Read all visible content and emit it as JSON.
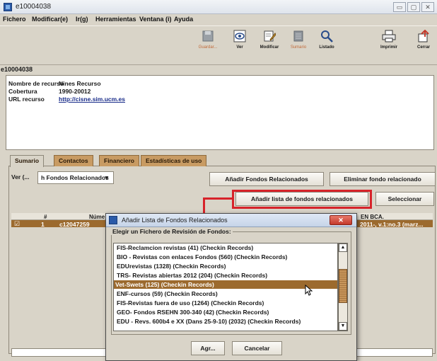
{
  "window": {
    "title": "e10004038",
    "min_glyph": "▭",
    "max_glyph": "▢",
    "close_glyph": "✕"
  },
  "menu": [
    {
      "label": "Fichero"
    },
    {
      "label": "Modificar(e)"
    },
    {
      "label": "Ir(g)"
    },
    {
      "label": "Herramientas"
    },
    {
      "label": "Ventana (i)"
    },
    {
      "label": "Ayuda"
    }
  ],
  "toolbar": {
    "guardar": "Guardar...",
    "ver": "Ver",
    "modificar": "Modificar",
    "sumario": "Sumario",
    "listado": "Listado",
    "imprimir": "Imprimir",
    "cerrar": "Cerrar"
  },
  "record": {
    "id": "e10004038",
    "fields": [
      {
        "label": "Nombre de recurso",
        "value": "Nines Recurso"
      },
      {
        "label": "Cobertura",
        "value": "1990-20012"
      },
      {
        "label": "URL recurso",
        "value": "http://cisne.sim.ucm.es"
      }
    ]
  },
  "tabs": [
    {
      "label": "Sumario"
    },
    {
      "label": "Contactos"
    },
    {
      "label": "Financiero"
    },
    {
      "label": "Estadísticas de uso"
    }
  ],
  "view": {
    "label": "Ver (...",
    "selected": "h Fondos Relacionados",
    "chevron": "▼"
  },
  "actions": {
    "add_related": "Añadir Fondos Relacionados",
    "remove_related": "Eliminar fondo relacionado",
    "add_list": "Añadir lista de fondos relacionados",
    "select": "Seleccionar"
  },
  "grid": {
    "col_hash": "#",
    "col_number": "Núme",
    "col_en_bca": "EN BCA.",
    "row": {
      "check": "☑",
      "num": "1",
      "code": "c12047259",
      "en_bca": "2011-, v.1:no.3 (marz..."
    }
  },
  "dialog": {
    "title": "Añadir Lista de Fondos Relacionados",
    "close_glyph": "✕",
    "group_label": "Elegir un Fichero de Revisión de Fondos:",
    "items": [
      "FIS-Reclamcion revistas (41) (Checkin Records)",
      "BIO - Revistas con enlaces Fondos (560) (Checkin Records)",
      "EDUrevistas (1328) (Checkin Records)",
      "TRS- Revistas abiertas 2012 (204) (Checkin Records)",
      "Vet-Swets (125) (Checkin Records)",
      "ENF-cursos (59) (Checkin Records)",
      "FIS-Revistas fuera de uso (1264) (Checkin Records)",
      "GEO- Fondos RSEHN 300-340 (42) (Checkin Records)",
      "EDU - Revs. 600b4 e XX (Dans 25-9-10) (2032) (Checkin Records)"
    ],
    "scroll_up": "▲",
    "scroll_down": "▼",
    "ok": "Agr...",
    "cancel": "Cancelar"
  },
  "colors": {
    "accent_brown": "#9c6a2e",
    "tab_orange": "#c89b63",
    "callout_red": "#d7232a",
    "link_blue": "#1a2d8a"
  }
}
